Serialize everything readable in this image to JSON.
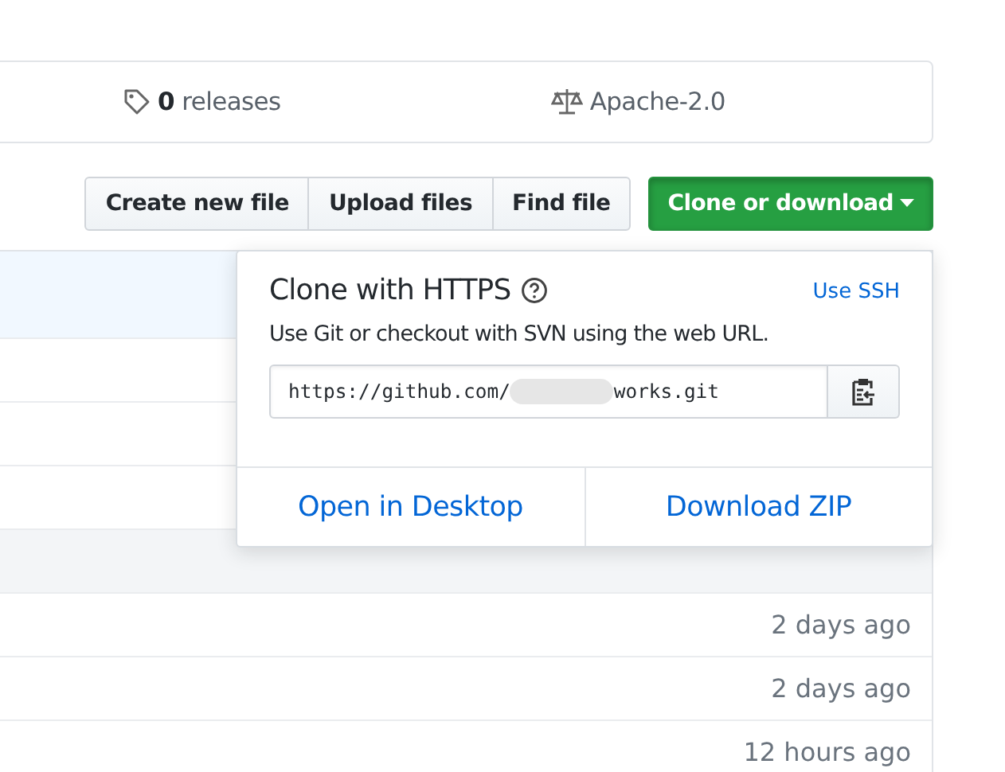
{
  "summary": {
    "releases_count": "0",
    "releases_label": "releases",
    "license": "Apache-2.0"
  },
  "file_buttons": [
    "Create new file",
    "Upload files",
    "Find file"
  ],
  "clone_button": {
    "label": "Clone or download",
    "expanded": true
  },
  "clone_popup": {
    "title": "Clone with HTTPS",
    "switch_link": "Use SSH",
    "description": "Use Git or checkout with SVN using the web URL.",
    "url_start": "https://github.com/",
    "url_redacted": true,
    "url_end": "works.git",
    "actions": [
      "Open in Desktop",
      "Download ZIP"
    ]
  },
  "file_rows": [
    {
      "kind": "highlighted"
    },
    {
      "kind": "plain"
    },
    {
      "kind": "plain"
    },
    {
      "kind": "plain"
    },
    {
      "kind": "shaded"
    },
    {
      "time": "2 days ago",
      "kind": "plain"
    },
    {
      "time": "2 days ago",
      "kind": "plain"
    },
    {
      "time": "12 hours ago",
      "kind": "plain"
    }
  ]
}
